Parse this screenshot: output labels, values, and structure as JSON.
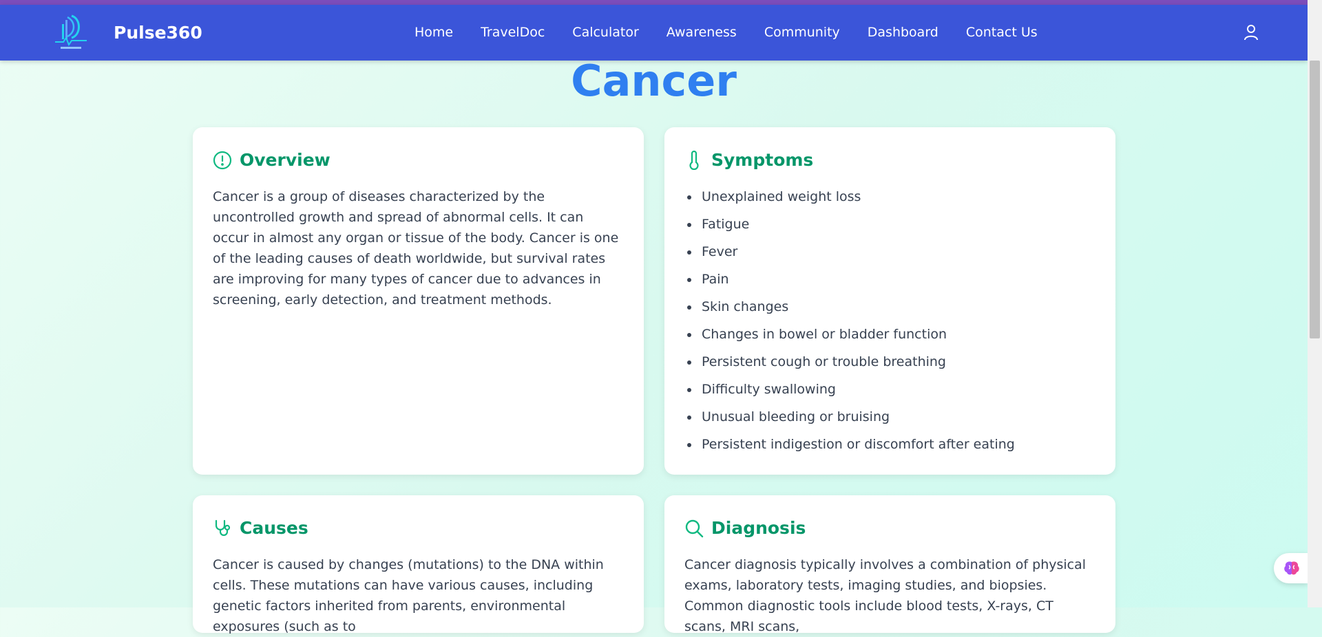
{
  "brand": {
    "name": "Pulse360",
    "logo_icon": "pulse360-logo"
  },
  "nav": {
    "links": [
      {
        "label": "Home"
      },
      {
        "label": "TravelDoc"
      },
      {
        "label": "Calculator"
      },
      {
        "label": "Awareness"
      },
      {
        "label": "Community"
      },
      {
        "label": "Dashboard"
      },
      {
        "label": "Contact Us"
      }
    ],
    "user_icon": "user-icon"
  },
  "page": {
    "title": "Cancer"
  },
  "overview": {
    "icon": "alert-circle-icon",
    "title": "Overview",
    "text": "Cancer is a group of diseases characterized by the uncontrolled growth and spread of abnormal cells. It can occur in almost any organ or tissue of the body. Cancer is one of the leading causes of death worldwide, but survival rates are improving for many types of cancer due to advances in screening, early detection, and treatment methods."
  },
  "symptoms": {
    "icon": "thermometer-icon",
    "title": "Symptoms",
    "items": [
      "Unexplained weight loss",
      "Fatigue",
      "Fever",
      "Pain",
      "Skin changes",
      "Changes in bowel or bladder function",
      "Persistent cough or trouble breathing",
      "Difficulty swallowing",
      "Unusual bleeding or bruising",
      "Persistent indigestion or discomfort after eating"
    ]
  },
  "causes": {
    "icon": "stethoscope-icon",
    "title": "Causes",
    "text": "Cancer is caused by changes (mutations) to the DNA within cells. These mutations can have various causes, including genetic factors inherited from parents, environmental exposures (such as to"
  },
  "diagnosis": {
    "icon": "search-icon",
    "title": "Diagnosis",
    "text": "Cancer diagnosis typically involves a combination of physical exams, laboratory tests, imaging studies, and biopsies. Common diagnostic tools include blood tests, X-rays, CT scans, MRI scans,"
  },
  "colors": {
    "navbar": "#3b55d9",
    "title": "#2f7ff0",
    "accent": "#059669",
    "icon_teal": "#10b981"
  },
  "floating_button": {
    "icon": "brain-icon"
  }
}
